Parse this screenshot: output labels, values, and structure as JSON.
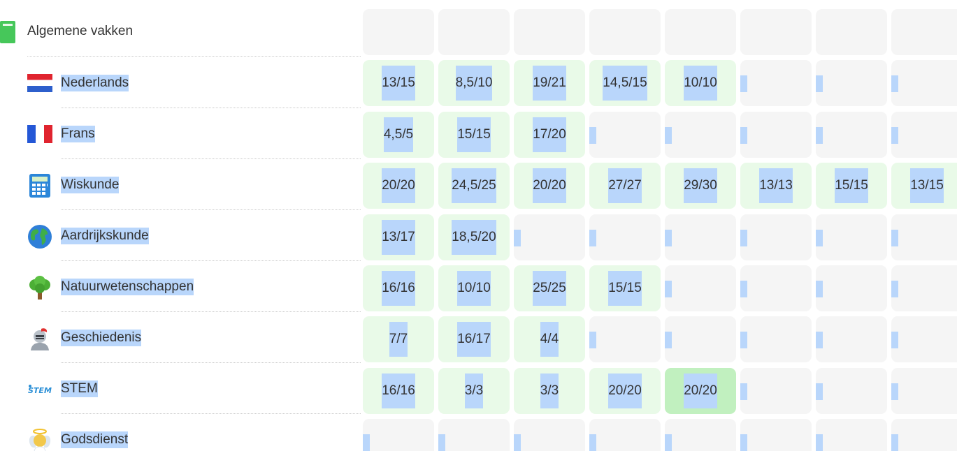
{
  "header": {
    "title": "Algemene vakken"
  },
  "subjects": [
    {
      "name": "Nederlands",
      "icon": "netherlands-flag-icon",
      "scores": [
        "13/15",
        "8,5/10",
        "19/21",
        "14,5/15",
        "10/10",
        "",
        "",
        ""
      ]
    },
    {
      "name": "Frans",
      "icon": "france-flag-icon",
      "scores": [
        "4,5/5",
        "15/15",
        "17/20",
        "",
        "",
        "",
        "",
        ""
      ]
    },
    {
      "name": "Wiskunde",
      "icon": "calculator-icon",
      "scores": [
        "20/20",
        "24,5/25",
        "20/20",
        "27/27",
        "29/30",
        "13/13",
        "15/15",
        "13/15"
      ]
    },
    {
      "name": "Aardrijkskunde",
      "icon": "globe-icon",
      "scores": [
        "13/17",
        "18,5/20",
        "",
        "",
        "",
        "",
        "",
        ""
      ]
    },
    {
      "name": "Natuurwetenschappen",
      "icon": "tree-icon",
      "scores": [
        "16/16",
        "10/10",
        "25/25",
        "15/15",
        "",
        "",
        "",
        ""
      ]
    },
    {
      "name": "Geschiedenis",
      "icon": "knight-icon",
      "scores": [
        "7/7",
        "16/17",
        "4/4",
        "",
        "",
        "",
        "",
        ""
      ]
    },
    {
      "name": "STEM",
      "icon": "stem-logo-icon",
      "scores": [
        "16/16",
        "3/3",
        "3/3",
        "20/20",
        "20/20",
        "",
        "",
        ""
      ]
    },
    {
      "name": "Godsdienst",
      "icon": "angel-icon",
      "scores": [
        "",
        "",
        "",
        "",
        "",
        "",
        "",
        ""
      ]
    }
  ],
  "colors": {
    "cell_empty": "#f5f5f5",
    "cell_scored": "#e9fae8",
    "cell_highlight": "#c1f0bf",
    "selection": "#b9d6fb"
  }
}
